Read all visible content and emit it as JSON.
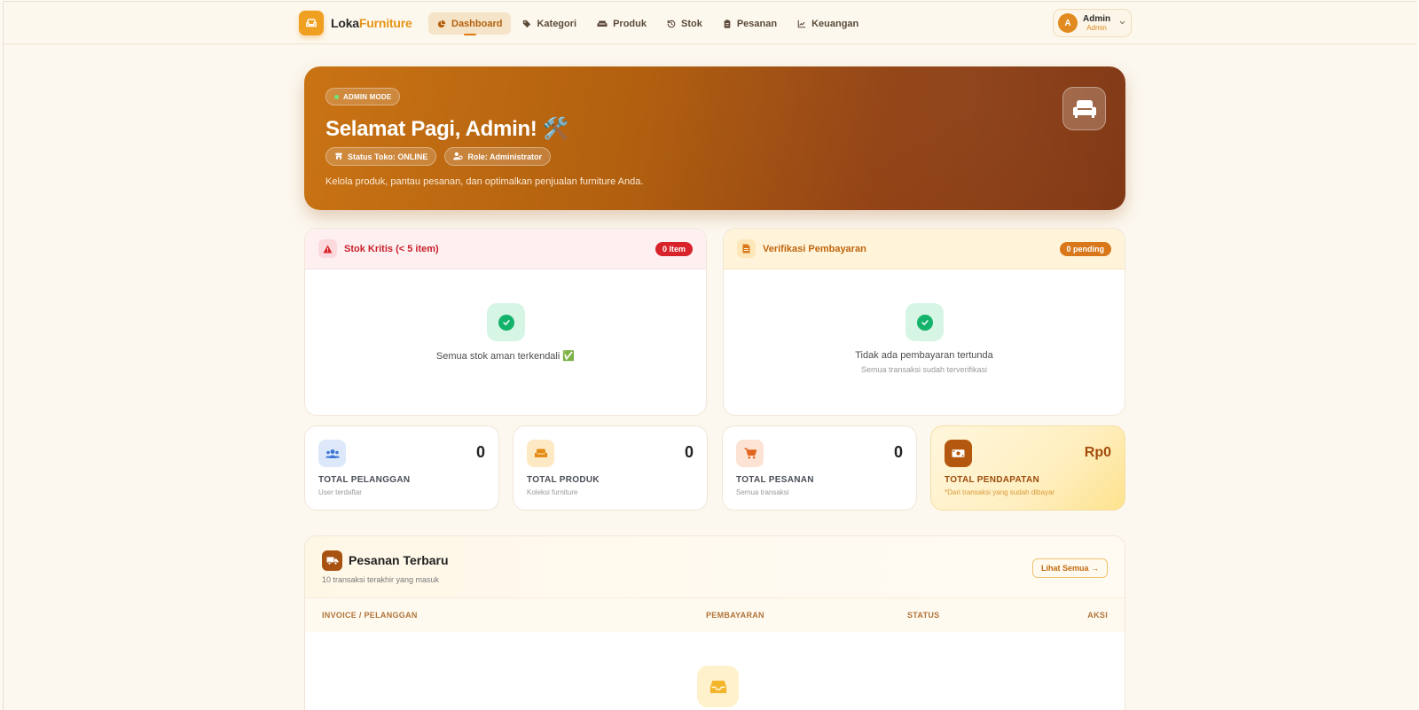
{
  "brand": {
    "name_part1": "Loka",
    "name_part2": "Furniture"
  },
  "nav": {
    "items": [
      {
        "label": "Dashboard",
        "icon": "pie-chart-icon",
        "active": true
      },
      {
        "label": "Kategori",
        "icon": "tag-icon"
      },
      {
        "label": "Produk",
        "icon": "sofa-icon"
      },
      {
        "label": "Stok",
        "icon": "history-icon"
      },
      {
        "label": "Pesanan",
        "icon": "clipboard-icon"
      },
      {
        "label": "Keuangan",
        "icon": "line-chart-icon"
      }
    ]
  },
  "user": {
    "initial": "A",
    "name": "Admin",
    "role": "Admin"
  },
  "hero": {
    "mode_badge": "ADMIN MODE",
    "title": "Selamat Pagi, Admin! 🛠️",
    "status_pill": "Status Toko: ONLINE",
    "role_pill": "Role: Administrator",
    "description": "Kelola produk, pantau pesanan, dan optimalkan penjualan furniture Anda."
  },
  "stock_card": {
    "title": "Stok Kritis (< 5 item)",
    "badge": "0 Item",
    "message": "Semua stok aman terkendali ✅"
  },
  "payment_card": {
    "title": "Verifikasi Pembayaran",
    "badge": "0 pending",
    "message": "Tidak ada pembayaran tertunda",
    "sub": "Semua transaksi sudah terverifikasi"
  },
  "stats": [
    {
      "value": "0",
      "label": "TOTAL PELANGGAN",
      "sub": "User terdaftar"
    },
    {
      "value": "0",
      "label": "TOTAL PRODUK",
      "sub": "Koleksi furniture"
    },
    {
      "value": "0",
      "label": "TOTAL PESANAN",
      "sub": "Semua transaksi"
    },
    {
      "value": "Rp0",
      "label": "TOTAL PENDAPATAN",
      "sub": "*Dari transaksi yang sudah dibayar"
    }
  ],
  "orders": {
    "title": "Pesanan Terbaru",
    "subtitle": "10 transaksi terakhir yang masuk",
    "see_all": "Lihat Semua →",
    "columns": [
      "INVOICE / PELANGGAN",
      "PEMBAYARAN",
      "STATUS",
      "AKSI"
    ]
  },
  "colors": {
    "accent": "#e59418",
    "hero_start": "#c97314",
    "hero_end": "#7e3410",
    "danger": "#d8232a",
    "warning": "#d8781a",
    "success": "#14b36b"
  }
}
